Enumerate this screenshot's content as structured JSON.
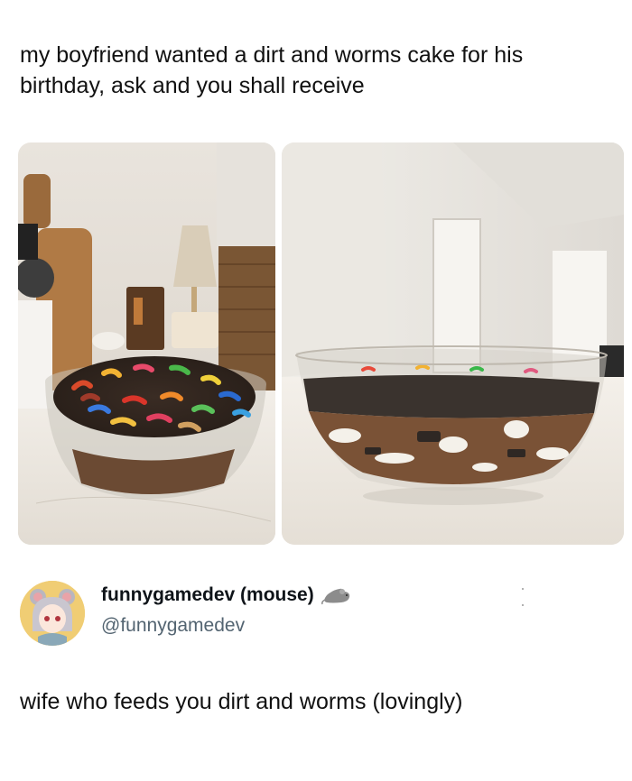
{
  "post": {
    "text": "my boyfriend wanted a dirt and worms cake for his birthday, ask and you shall receive",
    "photos": [
      {
        "name": "photo-bowl-top-view"
      },
      {
        "name": "photo-bowl-side-view"
      }
    ]
  },
  "reply": {
    "display_name": "funnygamedev (mouse)",
    "handle": "@funnygamedev",
    "name_emoji_icon": "rat-icon",
    "text": "wife who feeds you dirt and worms (lovingly)"
  },
  "colors": {
    "text": "#111111",
    "handle": "#536471"
  }
}
